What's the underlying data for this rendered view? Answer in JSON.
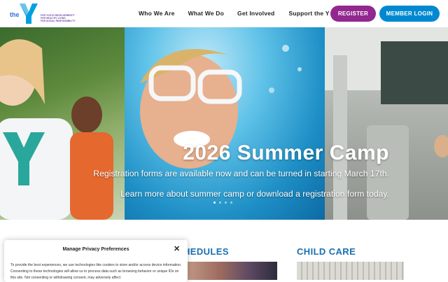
{
  "header": {
    "logo": {
      "prefix": "the",
      "letter": "Y",
      "taglines": [
        "FOR YOUTH DEVELOPMENT®",
        "FOR HEALTHY LIVING",
        "FOR SOCIAL RESPONSIBILITY"
      ]
    },
    "nav": [
      "Who We Are",
      "What We Do",
      "Get Involved",
      "Support the Y"
    ],
    "register_label": "REGISTER",
    "login_label": "MEMBER LOGIN"
  },
  "hero": {
    "title": "2026 Summer Camp",
    "line1": "Registration forms are available now and can be turned in starting March 17th.",
    "line2": "Learn more about summer camp or download a registration form today.",
    "slides_total": 4,
    "slide_active": 1
  },
  "sections": {
    "schedules_fragment": "HEDULES",
    "child_care": "CHILD CARE"
  },
  "privacy": {
    "title": "Manage Privacy Preferences",
    "close_icon": "close-icon",
    "text": "To provide the best experiences, we use technologies like cookies to store and/or access device information. Consenting to these technologies will allow us to process data such as browsing behavior or unique IDs on this site. Not consenting or withdrawing consent, may adversely affect"
  },
  "colors": {
    "register": "#92278f",
    "login": "#0089d0",
    "heading": "#1a6fb0"
  }
}
